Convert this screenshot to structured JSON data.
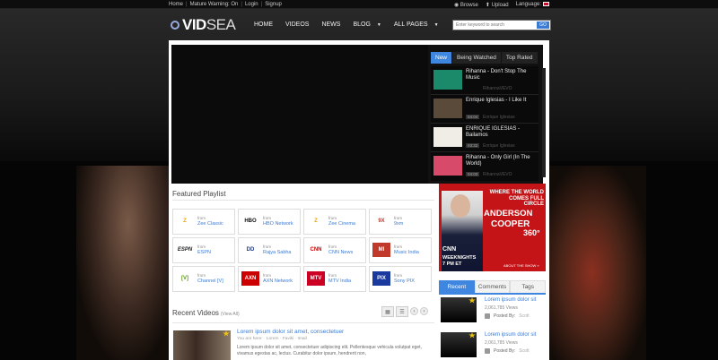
{
  "topbar": {
    "links": [
      "Home",
      "Mature Warning: On",
      "Login",
      "Signup"
    ],
    "browse": "Browse",
    "upload": "Upload",
    "language": "Language:"
  },
  "header": {
    "logo_bold": "VID",
    "logo_thin": "SEA",
    "nav": [
      "HOME",
      "VIDEOS",
      "NEWS",
      "BLOG",
      "ALL PAGES"
    ],
    "search_placeholder": "Enter keyword to search",
    "search_button": "GO"
  },
  "player": {
    "tabs": [
      "New",
      "Being Watched",
      "Top Rated"
    ],
    "active_tab": "New",
    "items": [
      {
        "title": "Rihanna - Don't Stop The Music",
        "duration": "",
        "channel": "RihannaVEVO",
        "thumb_color": "#1a8a6a"
      },
      {
        "title": "Enrique Iglesias - I Like It",
        "duration": "04:04",
        "channel": "Enrique Iglesias",
        "thumb_color": "#5a4a3a"
      },
      {
        "title": "ENRIQUE IGLESIAS - Bailamos",
        "duration": "03:32",
        "channel": "Enrique Iglesias",
        "thumb_color": "#f0ece6"
      },
      {
        "title": "Rihanna - Only Girl (In The World)",
        "duration": "04:03",
        "channel": "RihannaVEVO",
        "thumb_color": "#d84a6a"
      }
    ]
  },
  "featured": {
    "title": "Featured Playlist",
    "from_label": "from",
    "items": [
      {
        "logo": "Z",
        "name": "Zee Classic",
        "color": "#e8a200"
      },
      {
        "logo": "HBO",
        "name": "HBO Network",
        "color": "#111111"
      },
      {
        "logo": "Z",
        "name": "Zee Cinema",
        "color": "#e8a200"
      },
      {
        "logo": "9X",
        "name": "9xm",
        "color": "#c0392b"
      },
      {
        "logo": "ESPN",
        "name": "ESPN",
        "color": "#222222"
      },
      {
        "logo": "DD",
        "name": "Rajya Sabha",
        "color": "#1a3a8a"
      },
      {
        "logo": "CNN",
        "name": "CNN News",
        "color": "#cc0000"
      },
      {
        "logo": "MI",
        "name": "Music India",
        "color": "#c0392b"
      },
      {
        "logo": "[V]",
        "name": "Channel [V]",
        "color": "#5a9a10"
      },
      {
        "logo": "AXN",
        "name": "AXN Network",
        "color": "#cc0000"
      },
      {
        "logo": "MTV",
        "name": "MTV India",
        "color": "#cc0022"
      },
      {
        "logo": "PIX",
        "name": "Sony PIX",
        "color": "#1a3aa0"
      }
    ]
  },
  "recent": {
    "title": "Recent Videos",
    "view_all": "(View All)",
    "video": {
      "title": "Lorem ipsum dolor sit amet, consectetuer",
      "meta": "You are here:   ·   Lorem   ·   Faviki   ·   Imail",
      "desc": "Lorem ipsum dolor sit amet, consectetuer adipiscing elit. Pellentesque vehicula volutpat eget, vivamus egestas ac, lectus. Curabitur dolor ipsum, hendrerit non,"
    }
  },
  "ad": {
    "where": "WHERE THE WORLD COMES FULL CIRCLE",
    "name": "ANDERSON",
    "cooper": "COOPER",
    "num": "360°",
    "cnn": "CNN",
    "weeknights": "WEEKNIGHTS",
    "time": "7 PM ET",
    "about": "ABOUT THE SHOW »"
  },
  "side": {
    "tabs": [
      "Recent",
      "Comments",
      "Tags"
    ],
    "active_tab": "Recent",
    "items": [
      {
        "title": "Lorem ipsum dolor sit",
        "views": "2,061,785 Views",
        "posted": "Posted By:",
        "by": "Scott"
      },
      {
        "title": "Lorem ipsum dolor sit",
        "views": "2,061,785 Views",
        "posted": "Posted By:",
        "by": "Scott"
      }
    ]
  }
}
